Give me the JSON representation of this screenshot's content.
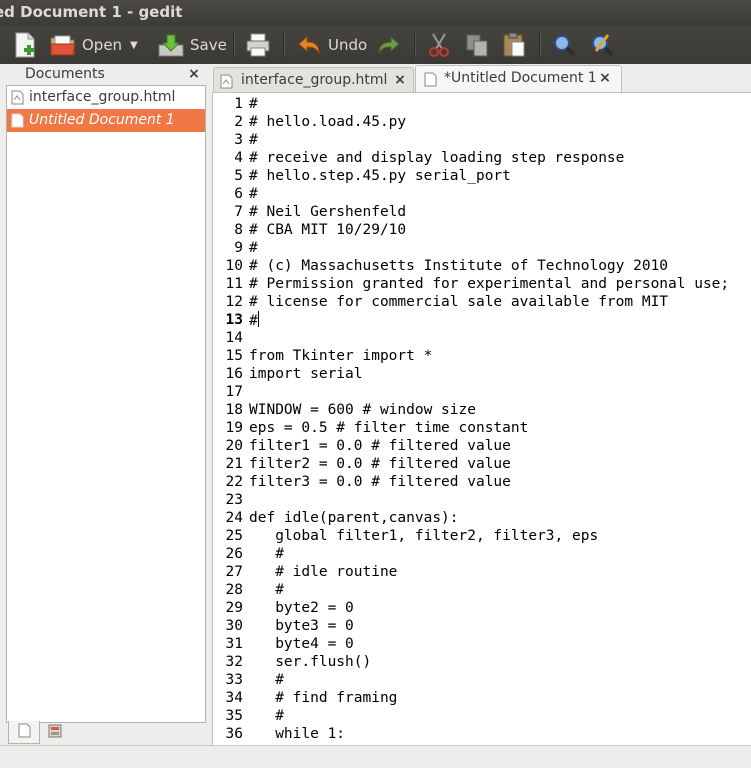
{
  "window": {
    "title": "ed Document 1 - gedit"
  },
  "toolbar": {
    "new_icon": "new-document-icon",
    "open_label": "Open",
    "open_dropdown_icon": "chevron-down-icon",
    "save_label": "Save",
    "print_icon": "printer-icon",
    "undo_label": "Undo",
    "redo_icon": "redo-icon",
    "cut_icon": "scissors-icon",
    "copy_icon": "copy-icon",
    "paste_icon": "clipboard-icon",
    "search_icon": "magnifier-icon",
    "replace_icon": "search-replace-icon"
  },
  "side_panel": {
    "title": "Documents",
    "close_glyph": "×",
    "items": [
      {
        "label": "interface_group.html",
        "selected": false
      },
      {
        "label": "Untitled Document 1",
        "selected": true
      }
    ],
    "tab_icons": [
      "documents-tab-icon",
      "file-browser-tab-icon"
    ]
  },
  "tabs": [
    {
      "label": "interface_group.html",
      "close_glyph": "×",
      "active": false
    },
    {
      "label": "*Untitled Document 1",
      "close_glyph": "×",
      "active": true
    }
  ],
  "editor": {
    "current_line": 13,
    "lines": [
      {
        "n": "1",
        "text": "#"
      },
      {
        "n": "2",
        "text": "# hello.load.45.py"
      },
      {
        "n": "3",
        "text": "#"
      },
      {
        "n": "4",
        "text": "# receive and display loading step response"
      },
      {
        "n": "5",
        "text": "# hello.step.45.py serial_port"
      },
      {
        "n": "6",
        "text": "#"
      },
      {
        "n": "7",
        "text": "# Neil Gershenfeld"
      },
      {
        "n": "8",
        "text": "# CBA MIT 10/29/10"
      },
      {
        "n": "9",
        "text": "#"
      },
      {
        "n": "10",
        "text": "# (c) Massachusetts Institute of Technology 2010"
      },
      {
        "n": "11",
        "text": "# Permission granted for experimental and personal use;"
      },
      {
        "n": "12",
        "text": "# license for commercial sale available from MIT"
      },
      {
        "n": "13",
        "text": "#"
      },
      {
        "n": "14",
        "text": ""
      },
      {
        "n": "15",
        "text": "from Tkinter import *"
      },
      {
        "n": "16",
        "text": "import serial"
      },
      {
        "n": "17",
        "text": ""
      },
      {
        "n": "18",
        "text": "WINDOW = 600 # window size"
      },
      {
        "n": "19",
        "text": "eps = 0.5 # filter time constant"
      },
      {
        "n": "20",
        "text": "filter1 = 0.0 # filtered value"
      },
      {
        "n": "21",
        "text": "filter2 = 0.0 # filtered value"
      },
      {
        "n": "22",
        "text": "filter3 = 0.0 # filtered value"
      },
      {
        "n": "23",
        "text": ""
      },
      {
        "n": "24",
        "text": "def idle(parent,canvas):"
      },
      {
        "n": "25",
        "text": "   global filter1, filter2, filter3, eps"
      },
      {
        "n": "26",
        "text": "   #"
      },
      {
        "n": "27",
        "text": "   # idle routine"
      },
      {
        "n": "28",
        "text": "   #"
      },
      {
        "n": "29",
        "text": "   byte2 = 0"
      },
      {
        "n": "30",
        "text": "   byte3 = 0"
      },
      {
        "n": "31",
        "text": "   byte4 = 0"
      },
      {
        "n": "32",
        "text": "   ser.flush()"
      },
      {
        "n": "33",
        "text": "   #"
      },
      {
        "n": "34",
        "text": "   # find framing"
      },
      {
        "n": "35",
        "text": "   #"
      },
      {
        "n": "36",
        "text": "   while 1:"
      }
    ]
  },
  "colors": {
    "selection": "#f07746",
    "titlebar": "#3c3b37",
    "panel_bg": "#ededeb"
  }
}
